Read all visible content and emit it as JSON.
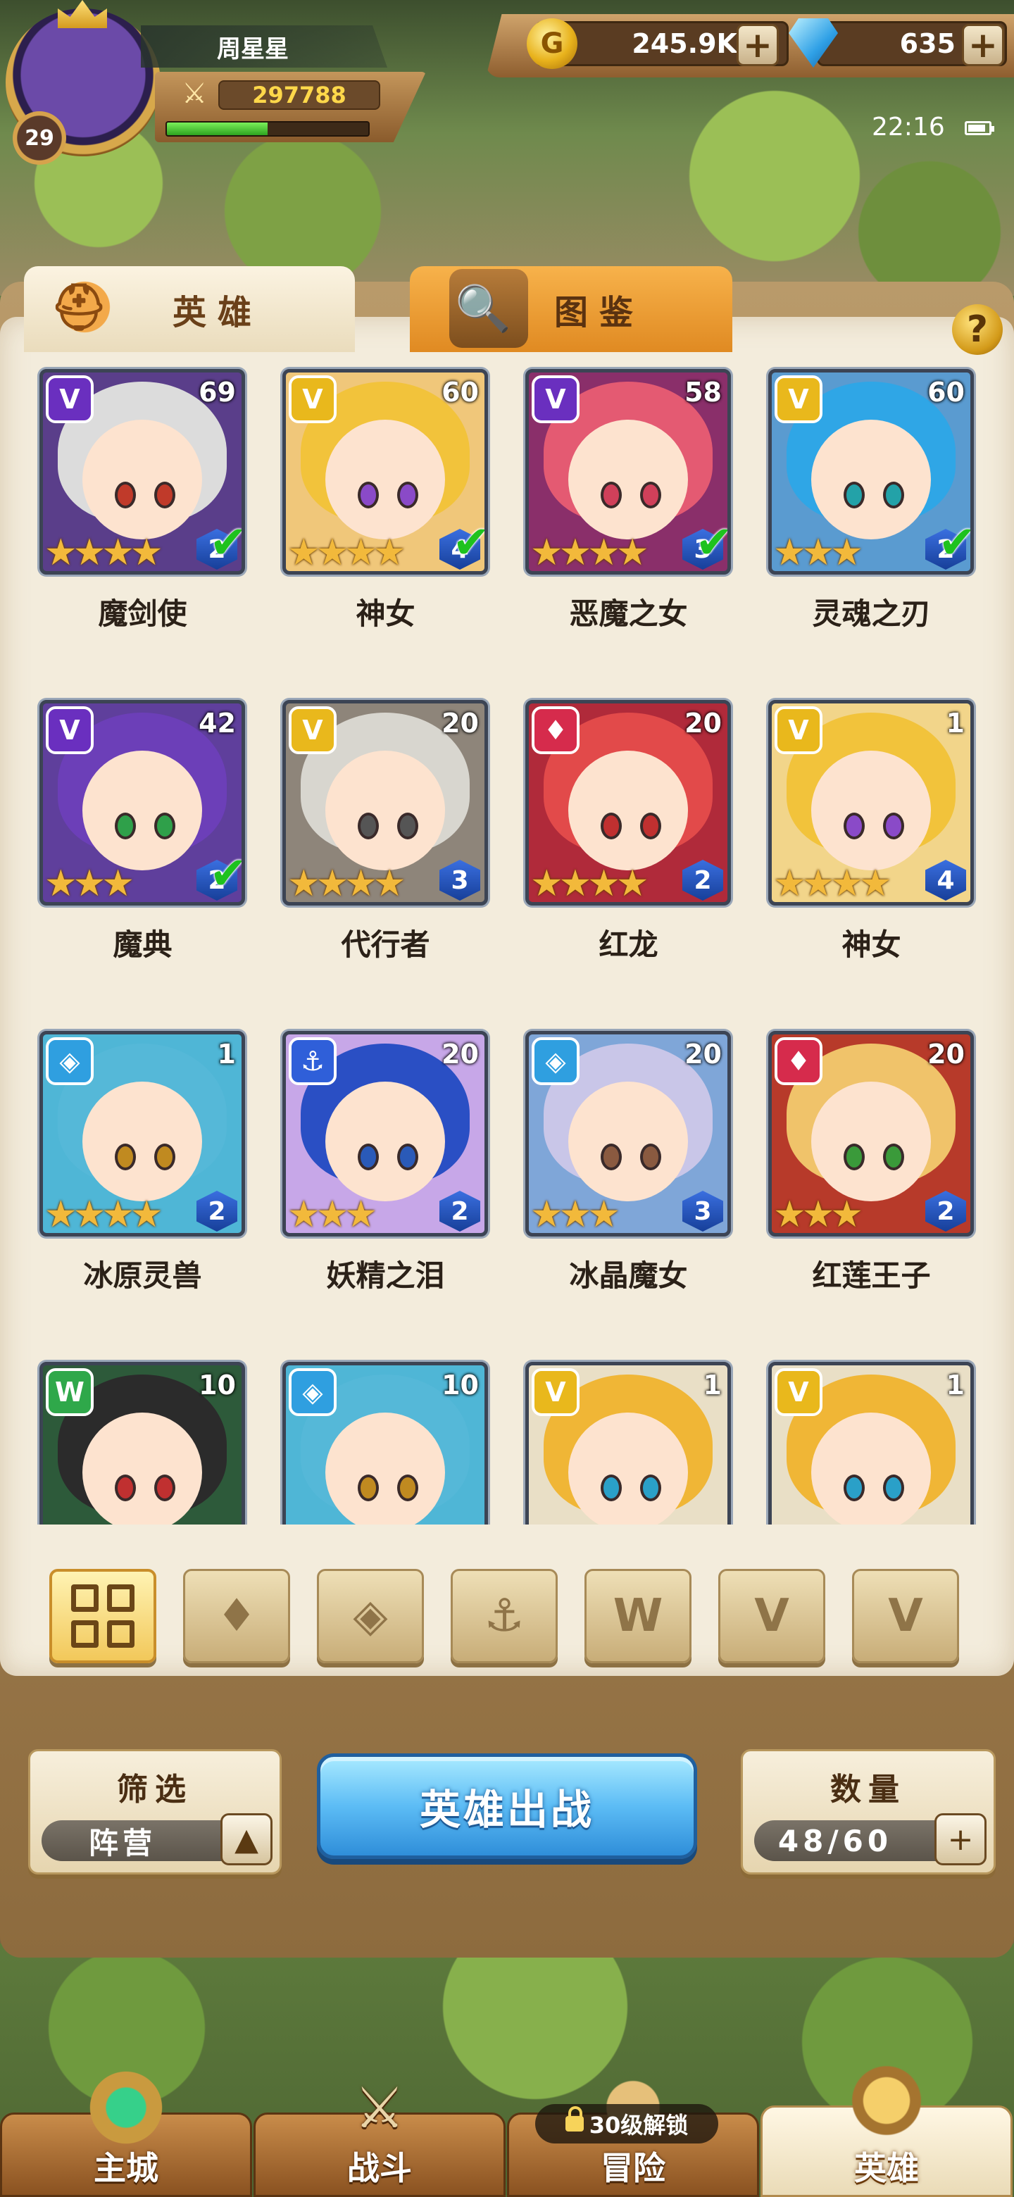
{
  "player": {
    "name": "周星星",
    "level": "29",
    "power": "297788",
    "exp_fraction": 0.5
  },
  "currency": {
    "gold": "245.9K",
    "gems": "635",
    "gold_symbol": "G"
  },
  "status": {
    "time": "22:16"
  },
  "tabs": {
    "heroes": "英雄",
    "codex": "图鉴"
  },
  "help_label": "?",
  "heroes": [
    {
      "name": "魔剑使",
      "level": "69",
      "stars": "★★★★",
      "rank": "2",
      "checked": true,
      "faction": "dark"
    },
    {
      "name": "神女",
      "level": "60",
      "stars": "★★★★",
      "rank": "4",
      "checked": true,
      "faction": "light"
    },
    {
      "name": "恶魔之女",
      "level": "58",
      "stars": "★★★★",
      "rank": "3",
      "checked": true,
      "faction": "dark"
    },
    {
      "name": "灵魂之刃",
      "level": "60",
      "stars": "★★★",
      "rank": "2",
      "checked": true,
      "faction": "light"
    },
    {
      "name": "魔典",
      "level": "42",
      "stars": "★★★",
      "rank": "2",
      "checked": true,
      "faction": "dark"
    },
    {
      "name": "代行者",
      "level": "20",
      "stars": "★★★★",
      "rank": "3",
      "checked": false,
      "faction": "light"
    },
    {
      "name": "红龙",
      "level": "20",
      "stars": "★★★★",
      "rank": "2",
      "checked": false,
      "faction": "fire"
    },
    {
      "name": "神女",
      "level": "1",
      "stars": "★★★★",
      "rank": "4",
      "checked": false,
      "faction": "light"
    },
    {
      "name": "冰原灵兽",
      "level": "1",
      "stars": "★★★★",
      "rank": "2",
      "checked": false,
      "faction": "ice"
    },
    {
      "name": "妖精之泪",
      "level": "20",
      "stars": "★★★",
      "rank": "2",
      "checked": false,
      "faction": "sea"
    },
    {
      "name": "冰晶魔女",
      "level": "20",
      "stars": "★★★",
      "rank": "3",
      "checked": false,
      "faction": "ice"
    },
    {
      "name": "红莲王子",
      "level": "20",
      "stars": "★★★",
      "rank": "2",
      "checked": false,
      "faction": "fire"
    },
    {
      "name": "",
      "level": "10",
      "stars": "",
      "rank": "",
      "checked": false,
      "faction": "beast"
    },
    {
      "name": "",
      "level": "10",
      "stars": "",
      "rank": "",
      "checked": false,
      "faction": "ice"
    },
    {
      "name": "",
      "level": "1",
      "stars": "",
      "rank": "",
      "checked": false,
      "faction": "light"
    },
    {
      "name": "",
      "level": "1",
      "stars": "",
      "rank": "",
      "checked": false,
      "faction": "light"
    }
  ],
  "faction_colors": {
    "dark": "#6a2fbf",
    "light": "#e9b81c",
    "fire": "#d62b4c",
    "ice": "#2f9fe0",
    "sea": "#2f5fd9",
    "beast": "#2fa84a"
  },
  "filters": [
    {
      "icon": "all-grid-icon",
      "active": true
    },
    {
      "icon": "fire-faction-icon",
      "active": false
    },
    {
      "icon": "ice-faction-icon",
      "active": false
    },
    {
      "icon": "anchor-faction-icon",
      "active": false
    },
    {
      "icon": "beast-faction-icon",
      "active": false
    },
    {
      "icon": "dark-faction-icon",
      "active": false
    },
    {
      "icon": "light-faction-icon",
      "active": false
    }
  ],
  "bottom": {
    "filter_title": "筛选",
    "filter_value": "阵营",
    "deploy_label": "英雄出战",
    "count_title": "数量",
    "count_value": "48/60"
  },
  "nav": {
    "main_city": "主城",
    "battle": "战斗",
    "adventure": "冒险",
    "heroes": "英雄",
    "lock_text": "30级解锁"
  }
}
